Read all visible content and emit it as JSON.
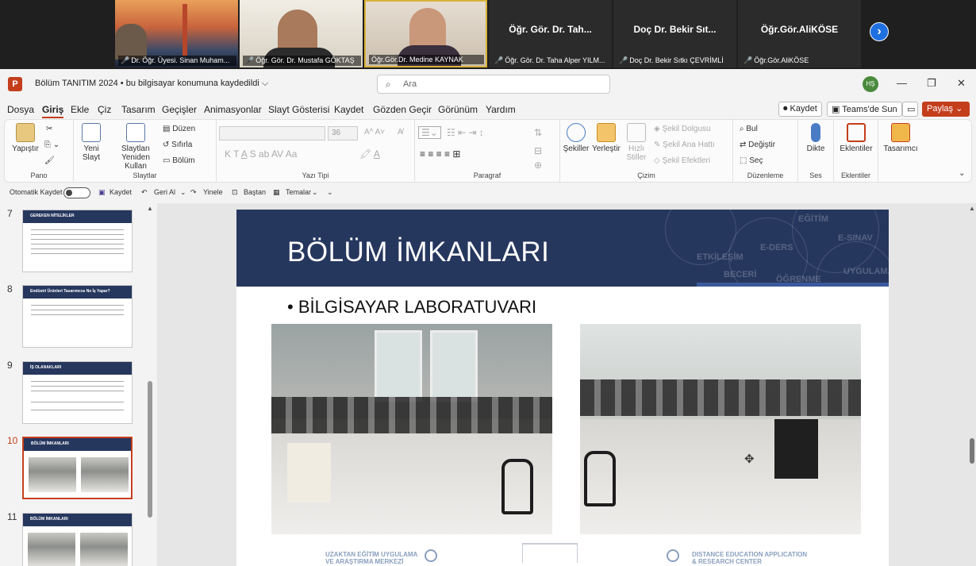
{
  "participants": [
    {
      "name": "Dr. Öğr. Üyesi. Sinan Muham...",
      "video": true
    },
    {
      "name": "Öğr. Gör. Dr. Mustafa GÖKTAŞ",
      "video": true
    },
    {
      "name": "Öğr.Gör.Dr. Medine KAYNAK",
      "video": true
    },
    {
      "name": "Öğr. Gör. Dr. Taha Alper YILM...",
      "big_label": "Öğr. Gör. Dr. Tah...",
      "video": false
    },
    {
      "name": "Doç Dr. Bekir Sıtkı ÇEVRİMLİ",
      "big_label": "Doç Dr. Bekir Sıt...",
      "video": false
    },
    {
      "name": "Öğr.Gör.AliKÖSE",
      "big_label": "Öğr.Gör.AliKÖSE",
      "video": false
    }
  ],
  "titlebar": {
    "app_icon": "P",
    "doc_title": "Bölüm TANITIM 2024 • bu bilgisayar konumuna kaydedildi ⌵",
    "search_placeholder": "Ara",
    "avatar_initials": "HŞ"
  },
  "menu": {
    "tabs": [
      "Dosya",
      "Giriş",
      "Ekle",
      "Çiz",
      "Tasarım",
      "Geçişler",
      "Animasyonlar",
      "Slayt Gösterisi",
      "Kaydet",
      "Gözden Geçir",
      "Görünüm",
      "Yardım"
    ],
    "active_tab": "Giriş",
    "record_btn": "⏺ Kaydet",
    "teams_btn": "Teams'de Sun",
    "share_btn": "Paylaş ⌄"
  },
  "ribbon": {
    "paste": "Yapıştır",
    "clipboard_group": "Pano",
    "new_slide": "Yeni Slayt",
    "reuse_slides": "Slaytları Yeniden Kullan",
    "layout": "Düzen",
    "reset": "Sıfırla",
    "section": "Bölüm",
    "slides_group": "Slaytlar",
    "font_size": "36",
    "font_group": "Yazı Tipi",
    "paragraph_group": "Paragraf",
    "shapes": "Şekiller",
    "arrange": "Yerleştir",
    "quick_styles": "Hızlı Stiller",
    "shape_fill": "Şekil Dolgusu",
    "shape_outline": "Şekil Ana Hattı",
    "shape_effects": "Şekil Efektleri",
    "drawing_group": "Çizim",
    "find": "Bul",
    "replace": "Değiştir",
    "select": "Seç",
    "editing_group": "Düzenleme",
    "dictate": "Dikte",
    "voice_group": "Ses",
    "addins": "Eklentiler",
    "addins_group": "Eklentiler",
    "designer": "Tasarımcı"
  },
  "qat": {
    "autosave": "Otomatik Kaydet",
    "save": "Kaydet",
    "undo": "Geri Al",
    "redo": "Yinele",
    "from_start": "Baştan",
    "themes": "Temalar"
  },
  "slides": [
    {
      "num": "7",
      "title": "GEREKEN NİTELİKLER"
    },
    {
      "num": "8",
      "title": "Endüstri Ürünleri Tasarımcısı Ne İş Yapar?"
    },
    {
      "num": "9",
      "title": "İŞ OLANAKLARI"
    },
    {
      "num": "10",
      "title": "BÖLÜM İMKANLARI"
    },
    {
      "num": "11",
      "title": "BÖLÜM İMKANLARI"
    }
  ],
  "active_slide": "10",
  "current_slide": {
    "title": "BÖLÜM İMKANLARI",
    "bullet": "• BİLGİSAYAR LABORATUVARI",
    "banner_words": [
      "EĞİTİM",
      "E-DERS",
      "E-SINAV",
      "ETKİLEŞİM",
      "BECERİ",
      "UYGULAMA",
      "ÖĞRENME"
    ],
    "footer_left": "UZAKTAN EĞİTİM UYGULAMA VE ARAŞTIRMA MERKEZİ",
    "footer_right": "DISTANCE EDUCATION APPLICATION & RESEARCH CENTER"
  }
}
